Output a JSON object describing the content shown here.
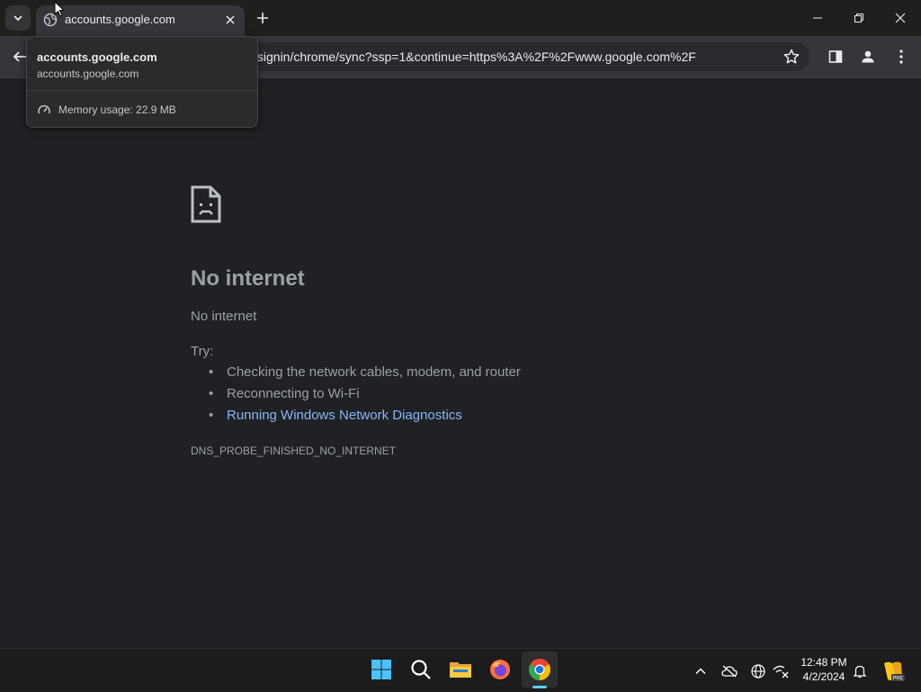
{
  "browser": {
    "tab": {
      "title": "accounts.google.com",
      "favicon": "globe-icon"
    },
    "url": "/signin/chrome/sync?ssp=1&continue=https%3A%2F%2Fwww.google.com%2F",
    "hover_card": {
      "title": "accounts.google.com",
      "subtitle": "accounts.google.com",
      "memory": "Memory usage: 22.9 MB"
    }
  },
  "error_page": {
    "icon": "sad-page-icon",
    "heading": "No internet",
    "description": "No internet",
    "try_label": "Try:",
    "suggestions": [
      "Checking the network cables, modem, and router",
      "Reconnecting to Wi-Fi",
      "Running Windows Network Diagnostics"
    ],
    "error_code": "DNS_PROBE_FINISHED_NO_INTERNET"
  },
  "taskbar": {
    "apps": [
      "start-icon",
      "search-icon",
      "file-explorer-icon",
      "firefox-icon",
      "chrome-icon"
    ],
    "time": "12:48 PM",
    "date": "4/2/2024"
  },
  "colors": {
    "link": "#8ab4f8",
    "background": "#202124",
    "taskbar_accent": "#60cdff"
  }
}
